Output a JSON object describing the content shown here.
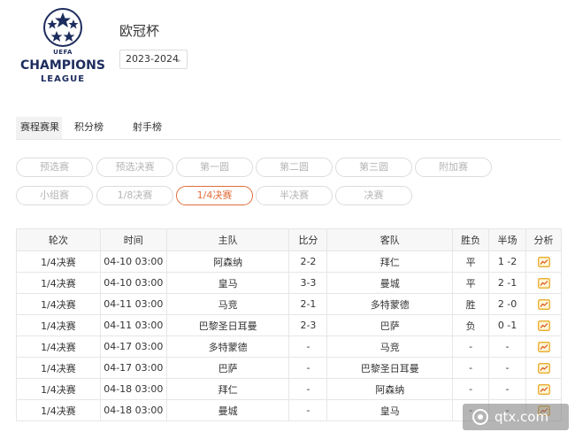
{
  "logo": {
    "uefa": "UEFA",
    "line1": "CHAMPIONS",
    "line2": "LEAGUE"
  },
  "competition": {
    "title": "欧冠杯",
    "season": "2023-2024"
  },
  "tabs": [
    {
      "label": "赛程赛果",
      "active": true
    },
    {
      "label": "积分榜",
      "active": false
    },
    {
      "label": "射手榜",
      "active": false
    }
  ],
  "rounds": [
    {
      "label": "预选赛",
      "active": false
    },
    {
      "label": "预选决赛",
      "active": false
    },
    {
      "label": "第一圆",
      "active": false
    },
    {
      "label": "第二圆",
      "active": false
    },
    {
      "label": "第三圆",
      "active": false
    },
    {
      "label": "附加赛",
      "active": false
    },
    {
      "label": "小组赛",
      "active": false
    },
    {
      "label": "1/8决赛",
      "active": false
    },
    {
      "label": "1/4决赛",
      "active": true
    },
    {
      "label": "半决赛",
      "active": false
    },
    {
      "label": "决赛",
      "active": false
    }
  ],
  "table": {
    "headers": [
      "轮次",
      "时间",
      "主队",
      "比分",
      "客队",
      "胜负",
      "半场",
      "分析"
    ],
    "rows": [
      [
        "1/4决赛",
        "04-10 03:00",
        "阿森纳",
        "2-2",
        "拜仁",
        "平",
        "1 -2"
      ],
      [
        "1/4决赛",
        "04-10 03:00",
        "皇马",
        "3-3",
        "曼城",
        "平",
        "2 -1"
      ],
      [
        "1/4决赛",
        "04-11 03:00",
        "马竞",
        "2-1",
        "多特蒙德",
        "胜",
        "2 -0"
      ],
      [
        "1/4决赛",
        "04-11 03:00",
        "巴黎圣日耳曼",
        "2-3",
        "巴萨",
        "负",
        "0 -1"
      ],
      [
        "1/4决赛",
        "04-17 03:00",
        "多特蒙德",
        "-",
        "马竞",
        "-",
        "-"
      ],
      [
        "1/4决赛",
        "04-17 03:00",
        "巴萨",
        "-",
        "巴黎圣日耳曼",
        "-",
        "-"
      ],
      [
        "1/4决赛",
        "04-18 03:00",
        "拜仁",
        "-",
        "阿森纳",
        "-",
        "-"
      ],
      [
        "1/4决赛",
        "04-18 03:00",
        "曼城",
        "-",
        "皇马",
        "-",
        "-"
      ]
    ],
    "analysis_icon": "analysis-chart-icon"
  },
  "watermark": {
    "text": "qtx.com"
  },
  "colors": {
    "accent": "#e06d3a",
    "logo_navy": "#1d2c5e",
    "analysis_icon": "#e8a317"
  }
}
